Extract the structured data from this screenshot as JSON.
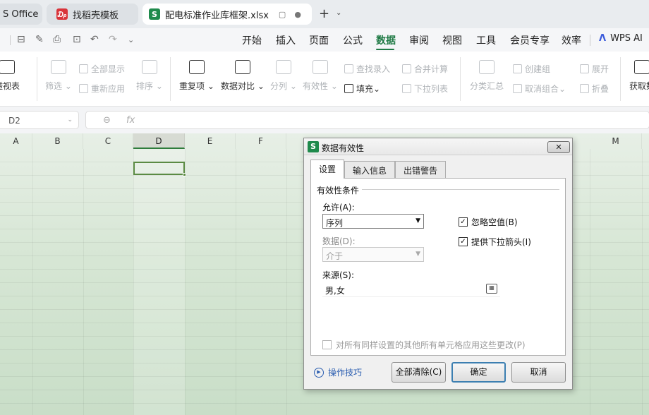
{
  "tabs": {
    "office_label": "S Office",
    "template_label": "找稻壳模板",
    "file_label": "配电标准作业库框架.xlsx",
    "template_icon": "wps-docer-icon",
    "file_icon": "wps-spreadsheet-icon",
    "new_tab": "+"
  },
  "menu": {
    "items": [
      "开始",
      "插入",
      "页面",
      "公式",
      "数据",
      "审阅",
      "视图",
      "工具",
      "会员专享",
      "效率"
    ],
    "active": "数据",
    "wps_ai": "WPS AI",
    "accent": "#1f7a45"
  },
  "ribbon": {
    "pivot_label": "透视表",
    "filter_label": "筛选",
    "show_all_label": "全部显示",
    "reapply_label": "重新应用",
    "sort_label": "排序",
    "duplicates_label": "重复项",
    "compare_label": "数据对比",
    "split_label": "分列",
    "validation_label": "有效性",
    "lookup_label": "查找录入",
    "fill_label": "填充",
    "merge_calc_label": "合并计算",
    "dropdown_list_label": "下拉列表",
    "subtotal_label": "分类汇总",
    "create_group_label": "创建组",
    "ungroup_label": "取消组合",
    "expand_label": "展开",
    "collapse_label": "折叠",
    "get_data_label": "获取数"
  },
  "formula_bar": {
    "cell_ref": "D2",
    "fx": "fx"
  },
  "sheet": {
    "columns": [
      "A",
      "B",
      "C",
      "D",
      "E",
      "F",
      "M"
    ],
    "selected_column": "D",
    "selected_cell": "D2"
  },
  "dialog": {
    "title": "数据有效性",
    "close_symbol": "✕",
    "tabs": [
      "设置",
      "输入信息",
      "出错警告"
    ],
    "active_tab": "设置",
    "group_label": "有效性条件",
    "allow_label": "允许(A):",
    "allow_value": "序列",
    "data_label": "数据(D):",
    "data_value": "介于",
    "ignore_blank_label": "忽略空值(B)",
    "ignore_blank_checked": true,
    "dropdown_arrow_label": "提供下拉箭头(I)",
    "dropdown_arrow_checked": true,
    "source_label": "来源(S):",
    "source_value": "男,女",
    "apply_all_label": "对所有同样设置的其他所有单元格应用这些更改(P)",
    "apply_all_checked": false,
    "tips_label": "操作技巧",
    "clear_all_button": "全部清除(C)",
    "ok_button": "确定",
    "cancel_button": "取消"
  }
}
